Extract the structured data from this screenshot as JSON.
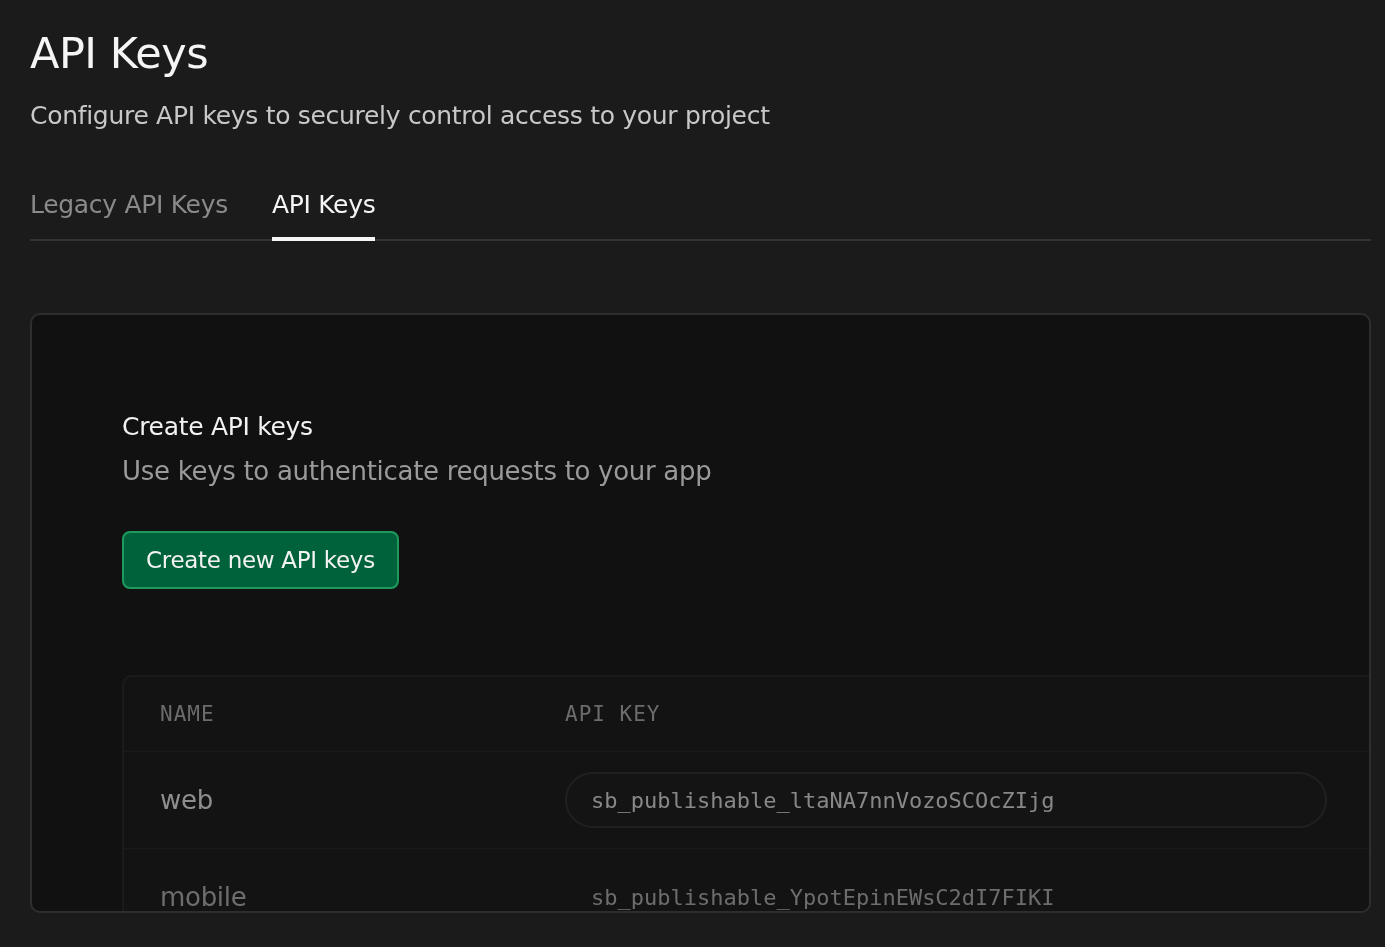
{
  "title": "API Keys",
  "subtitle": "Configure API keys to securely control access to your project",
  "tabs": [
    {
      "label": "Legacy API Keys",
      "selected": false
    },
    {
      "label": "API Keys",
      "selected": true
    }
  ],
  "card": {
    "heading": "Create API keys",
    "description": "Use keys to authenticate requests to your app",
    "button": "Create new API keys",
    "table": {
      "columns": [
        "NAME",
        "API KEY"
      ],
      "rows": [
        {
          "name": "web",
          "key": "sb_publishable_ltaNA7nnVozoSCOcZIjg"
        },
        {
          "name": "mobile",
          "key": "sb_publishable_YpotEpinEWsC2dI7FIKI"
        }
      ]
    }
  }
}
